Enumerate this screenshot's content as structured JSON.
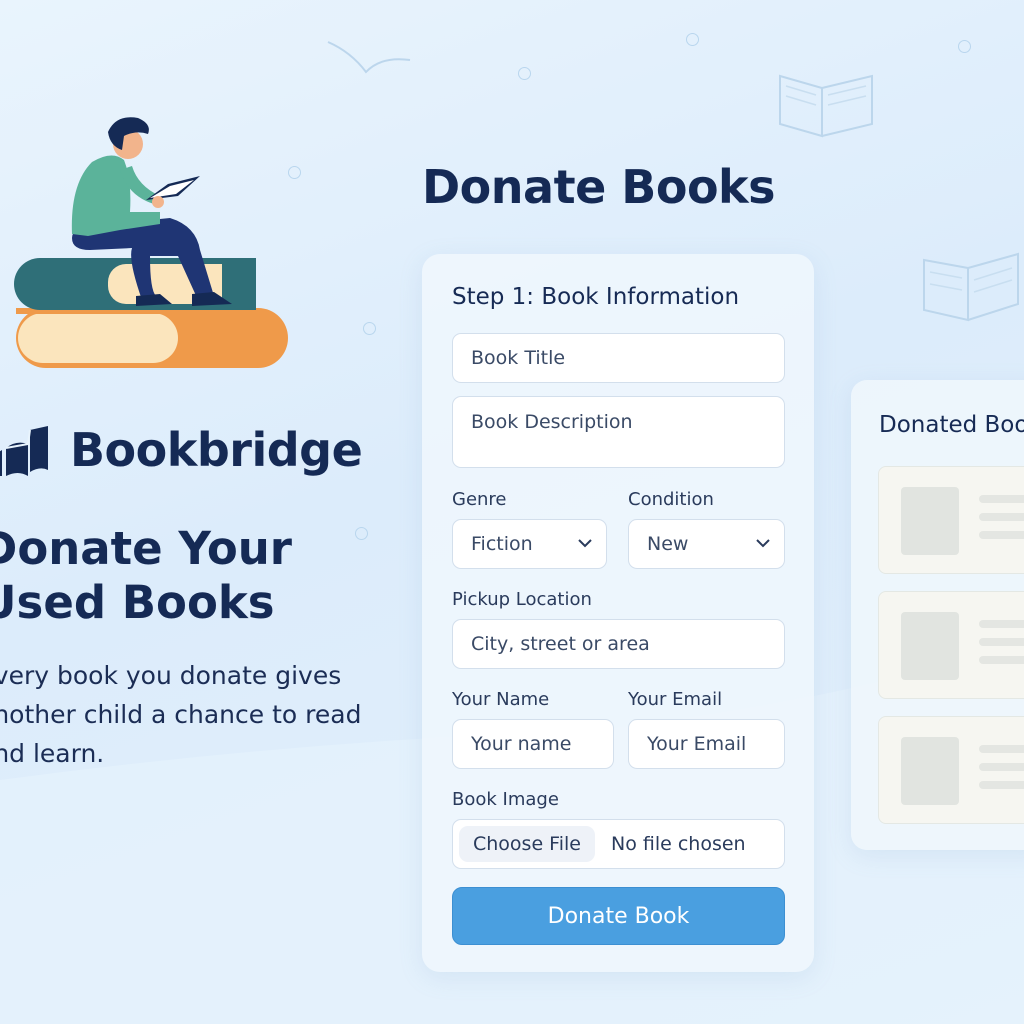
{
  "brand": {
    "name": "Bookbridge"
  },
  "hero": {
    "headline_line1": "Donate Your",
    "headline_line2": "Used Books",
    "tagline_line1": "Every book you donate gives",
    "tagline_line2": "another child a chance to read",
    "tagline_line3": "and learn."
  },
  "page": {
    "title": "Donate Books"
  },
  "form": {
    "step_title": "Step 1: Book Information",
    "book_title_placeholder": "Book Title",
    "book_description_placeholder": "Book Description",
    "genre_label": "Genre",
    "genre_value": "Fiction",
    "condition_label": "Condition",
    "condition_value": "New",
    "pickup_label": "Pickup Location",
    "pickup_placeholder": "City, street or area",
    "name_label": "Your Name",
    "name_placeholder": "Your name",
    "email_label": "Your Email",
    "email_placeholder": "Your Email",
    "image_label": "Book Image",
    "choose_file": "Choose File",
    "no_file": "No file chosen",
    "submit": "Donate Book"
  },
  "donated": {
    "title": "Donated Books"
  },
  "colors": {
    "accent": "#4a9fe0",
    "navy": "#152a55",
    "background": "#e3f0fb"
  },
  "icons": [
    "book-stack-reader-illustration",
    "bookbridge-logo-icon",
    "chevron-down-icon",
    "open-book-icon",
    "bird-icon"
  ]
}
